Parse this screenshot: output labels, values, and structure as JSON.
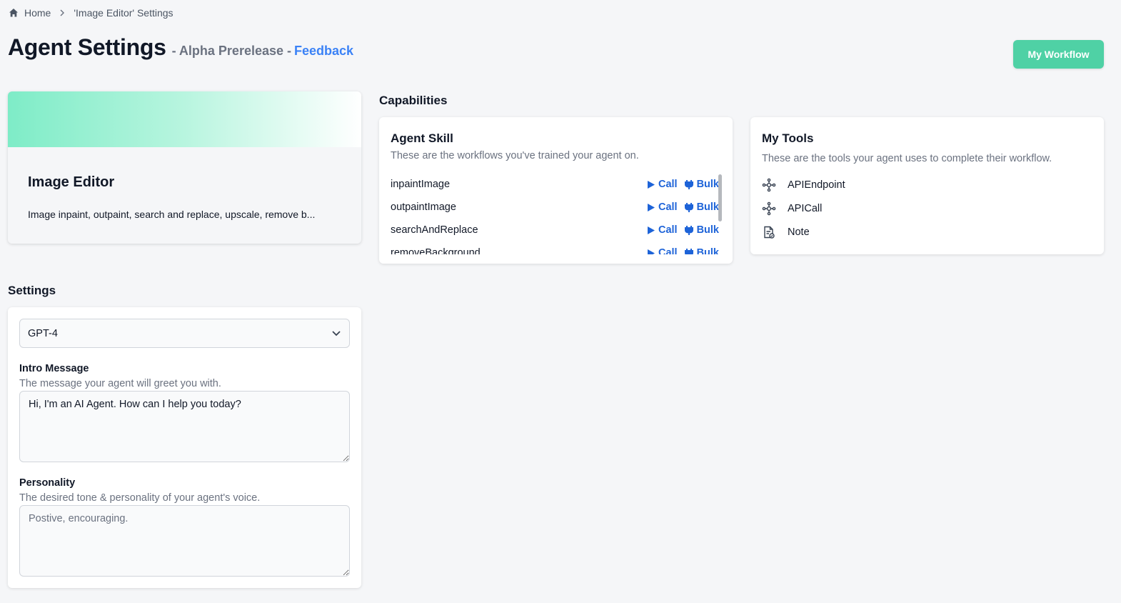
{
  "breadcrumb": {
    "home": "Home",
    "current": "'Image Editor' Settings"
  },
  "header": {
    "title": "Agent Settings",
    "subtitle": "- Alpha Prerelease -",
    "feedback": "Feedback",
    "workflow_button": "My Workflow"
  },
  "agent": {
    "name": "Image Editor",
    "description": "Image inpaint, outpaint, search and replace, upscale, remove b..."
  },
  "capabilities": {
    "label": "Capabilities",
    "skill": {
      "title": "Agent Skill",
      "subtitle": "These are the workflows you've trained your agent on.",
      "call_label": "Call",
      "bulk_label": "Bulk",
      "items": [
        "inpaintImage",
        "outpaintImage",
        "searchAndReplace",
        "removeBackground"
      ]
    },
    "tools": {
      "title": "My Tools",
      "subtitle": "These are the tools your agent uses to complete their workflow.",
      "items": [
        {
          "label": "APIEndpoint",
          "icon": "api-node-icon"
        },
        {
          "label": "APICall",
          "icon": "api-node-icon"
        },
        {
          "label": "Note",
          "icon": "note-icon"
        }
      ]
    }
  },
  "settings": {
    "label": "Settings",
    "model": "GPT-4",
    "intro": {
      "label": "Intro Message",
      "help": "The message your agent will greet you with.",
      "value": "Hi, I'm an AI Agent. How can I help you today?"
    },
    "personality": {
      "label": "Personality",
      "help": "The desired tone & personality of your agent's voice.",
      "placeholder": "Postive, encouraging."
    }
  },
  "colors": {
    "accent": "#4fd1a5",
    "link": "#3b82f6",
    "action": "#1d63d8"
  }
}
